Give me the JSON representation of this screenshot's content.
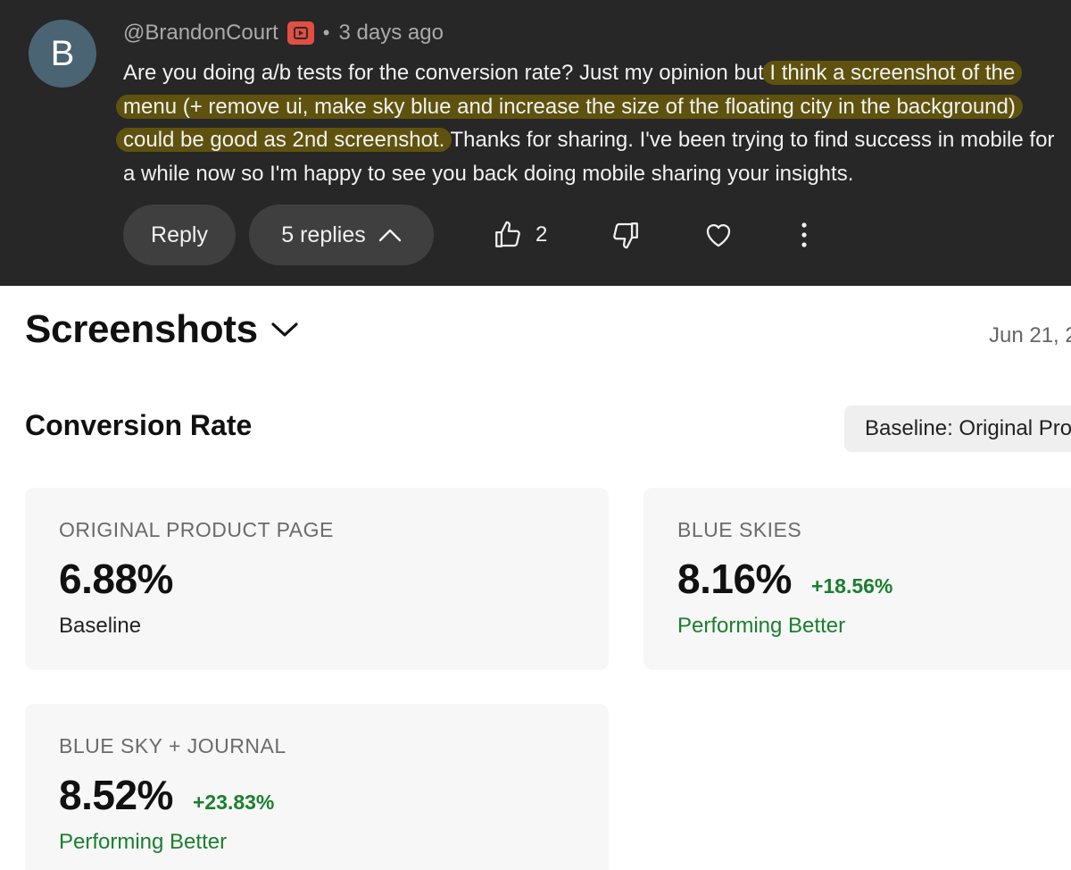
{
  "comment": {
    "avatar_letter": "B",
    "author": "@BrandonCourt",
    "separator": "•",
    "time": "3 days ago",
    "text_part1": "Are you doing a/b tests for the conversion rate? Just my opinion but",
    "text_highlight": "I think a screenshot of the menu (+ remove ui, make sky blue and increase the size of the floating city in the background) could be good as 2nd screenshot.",
    "text_part2": "Thanks for sharing. I've been trying to find success in mobile for a while now so I'm happy to see you back doing mobile sharing your insights.",
    "highlight_color": "#5f520e",
    "reply_label": "Reply",
    "replies_label": "5 replies",
    "like_count": "2",
    "icons": {
      "badge": "youtube-creator-badge-icon",
      "replies_toggle": "chevron-up-icon",
      "like": "thumbs-up-icon",
      "dislike": "thumbs-down-icon",
      "heart": "heart-icon",
      "more": "more-vertical-icon"
    }
  },
  "analytics": {
    "page_title": "Screenshots",
    "date": "Jun 21, 2",
    "section_title": "Conversion Rate",
    "baseline_select": "Baseline: Original Pro",
    "positive_color": "#1a7f2f",
    "cards": [
      {
        "label": "ORIGINAL PRODUCT PAGE",
        "value": "6.88%",
        "delta": "",
        "status": "Baseline"
      },
      {
        "label": "BLUE SKIES",
        "value": "8.16%",
        "delta": "+18.56%",
        "status": "Performing Better"
      },
      {
        "label": "BLUE SKY + JOURNAL",
        "value": "8.52%",
        "delta": "+23.83%",
        "status": "Performing Better"
      }
    ]
  }
}
